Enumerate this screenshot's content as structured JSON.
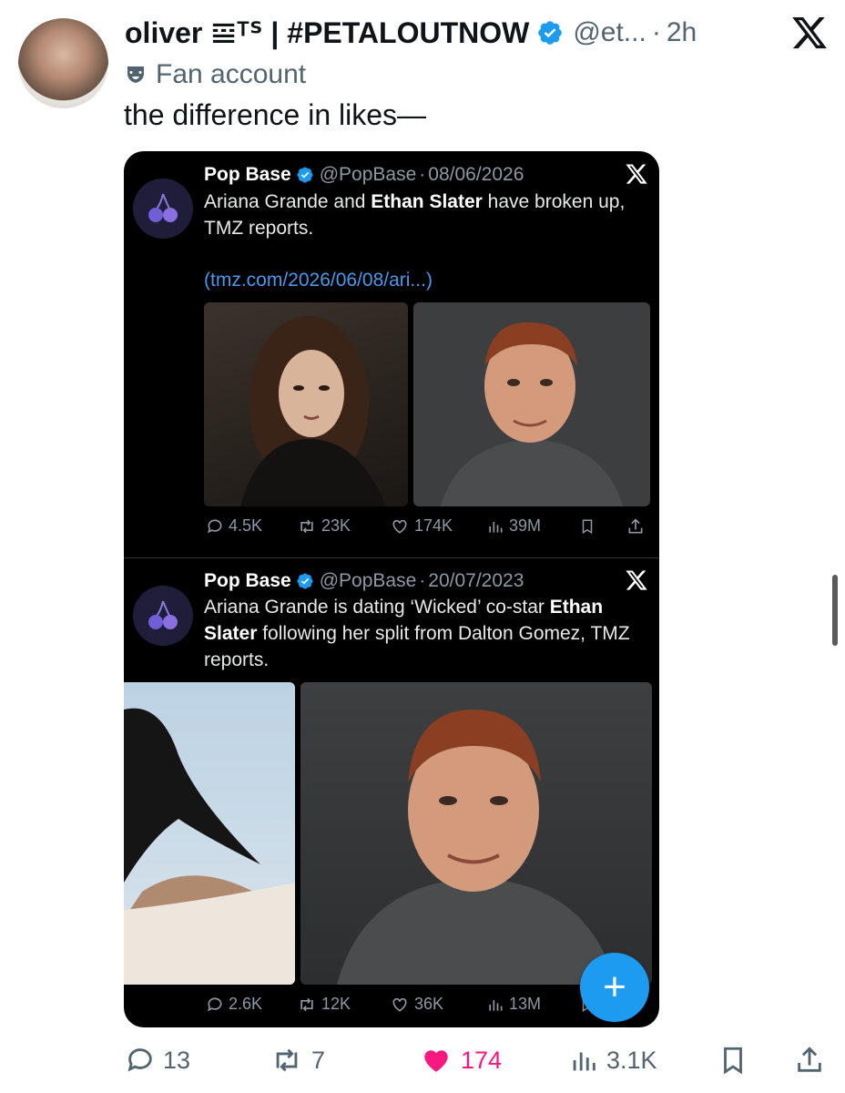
{
  "post": {
    "display_name": "oliver 𝌘ᵀᔆ | #PETALOUTNOW",
    "handle": "@et...",
    "separator": "·",
    "time": "2h",
    "label": "Fan account",
    "text": "the difference in likes—"
  },
  "quote1": {
    "name": "Pop Base",
    "handle": "@PopBase",
    "dot": "·",
    "date": "08/06/2026",
    "text_a": "Ariana Grande and ",
    "text_bold": "Ethan Slater",
    "text_b": " have broken up, TMZ reports.",
    "link": "(tmz.com/2026/06/08/ari...)",
    "replies": "4.5K",
    "reposts": "23K",
    "likes": "174K",
    "views": "39M"
  },
  "quote2": {
    "name": "Pop Base",
    "handle": "@PopBase",
    "dot": "·",
    "date": "20/07/2023",
    "text_a": "Ariana Grande is dating ‘Wicked’ co-star ",
    "text_bold1": "Ethan Slater",
    "text_b": " following her split from Dalton Gomez, TMZ reports.",
    "replies": "2.6K",
    "reposts": "12K",
    "likes": "36K",
    "views": "13M"
  },
  "fab_label": "+",
  "actions": {
    "replies": "13",
    "reposts": "7",
    "likes": "174",
    "views": "3.1K"
  },
  "colors": {
    "verified": "#1d9bf0",
    "like_active": "#f91880",
    "link": "#4a99e9",
    "fab": "#1d9bf0"
  }
}
